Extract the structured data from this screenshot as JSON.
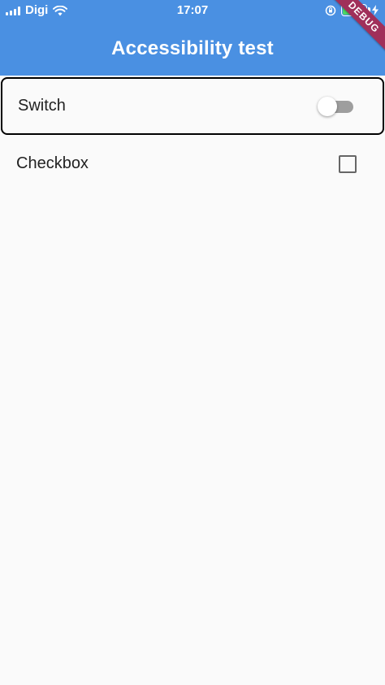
{
  "status_bar": {
    "carrier": "Digi",
    "time": "17:07",
    "signal_icon": "signal-bars-icon",
    "wifi_icon": "wifi-icon",
    "rotation_lock_icon": "rotation-lock-icon",
    "battery_icon": "battery-icon",
    "charging_icon": "charging-bolt-icon",
    "battery_fill_fraction": 0.8
  },
  "app_bar": {
    "title": "Accessibility test"
  },
  "debug_banner": {
    "label": "DEBUG"
  },
  "list": {
    "switch_tile": {
      "label": "Switch",
      "value": false
    },
    "checkbox_tile": {
      "label": "Checkbox",
      "value": false
    }
  },
  "colors": {
    "primary": "#4A90E2",
    "background": "#FAFAFA",
    "debug_banner": "#A0305A",
    "battery_green": "#4CD964",
    "switch_track_off": "#9E9E9E",
    "checkbox_border": "#666666",
    "focus_outline": "#000000"
  }
}
